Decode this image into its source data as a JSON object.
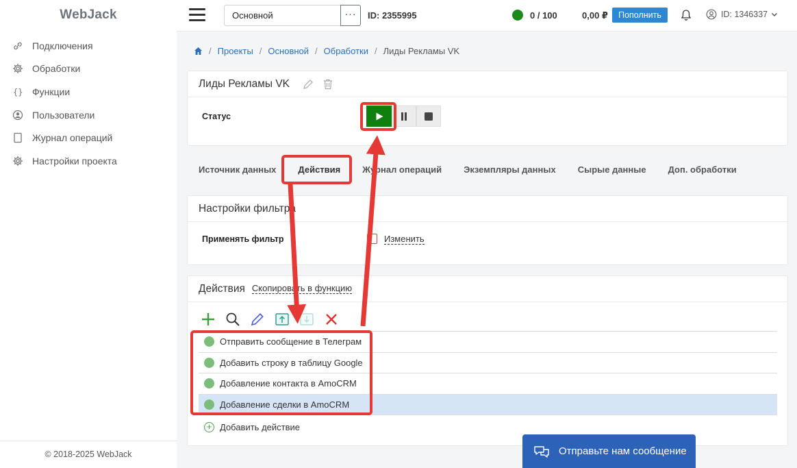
{
  "app": {
    "logo": "WebJack",
    "footer": "© 2018-2025 WebJack"
  },
  "sidebar": {
    "items": [
      {
        "label": "Подключения",
        "icon": "link-icon"
      },
      {
        "label": "Обработки",
        "icon": "gear-icon"
      },
      {
        "label": "Функции",
        "icon": "braces-icon"
      },
      {
        "label": "Пользователи",
        "icon": "user-circle-icon"
      },
      {
        "label": "Журнал операций",
        "icon": "journal-icon"
      },
      {
        "label": "Настройки проекта",
        "icon": "gear-icon"
      }
    ]
  },
  "header": {
    "project_select": "Основной",
    "more": "···",
    "project_id": "ID: 2355995",
    "counter": "0 / 100",
    "balance": "0,00 ₽",
    "topup_label": "Пополнить",
    "user_id": "ID: 1346337",
    "colors": {
      "accent": "#2e87d3",
      "status_ok": "#1a8a1a"
    }
  },
  "breadcrumb": {
    "items": [
      "Проекты",
      "Основной",
      "Обработки"
    ],
    "current": "Лиды Рекламы VK"
  },
  "processing": {
    "title": "Лиды Рекламы VK",
    "status_label": "Статус"
  },
  "tabs": [
    "Источник данных",
    "Действия",
    "Журнал операций",
    "Экземпляры данных",
    "Сырые данные",
    "Доп. обработки"
  ],
  "filter": {
    "title": "Настройки фильтра",
    "apply_label": "Применять фильтр",
    "edit_label": "Изменить"
  },
  "actions": {
    "title": "Действия",
    "copy_label": "Скопировать в функцию",
    "items": [
      "Отправить сообщение в Телеграм",
      "Добавить строку в таблицу Google",
      "Добавление контакта в AmoCRM",
      "Добавление сделки в AmoCRM"
    ],
    "add_label": "Добавить действие"
  },
  "chat": {
    "label": "Отправьте нам сообщение"
  }
}
